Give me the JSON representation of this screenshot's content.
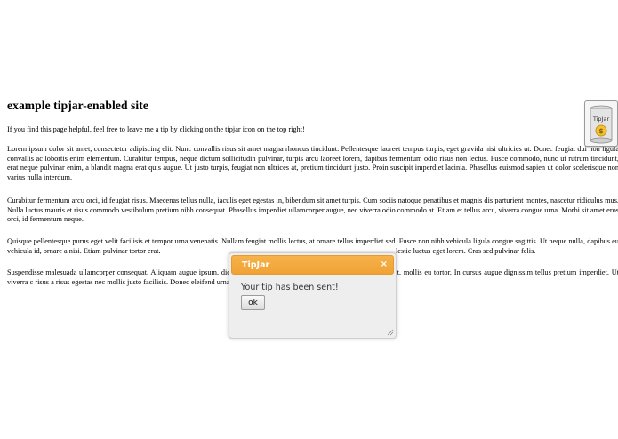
{
  "page": {
    "title": "example tipjar-enabled site",
    "intro": "If you find this page helpful, feel free to leave me a tip by clicking on the tipjar icon on the top right!",
    "paragraphs": [
      "Lorem ipsum dolor sit amet, consectetur adipiscing elit. Nunc convallis risus sit amet magna rhoncus tincidunt. Pellentesque laoreet tempus turpis, eget gravida nisi ultricies ut. Donec feugiat dui non ligula convallis ac lobortis enim elementum. Curabitur tempus, neque dictum sollicitudin pulvinar, turpis arcu laoreet lorem, dapibus fermentum odio risus non lectus. Fusce commodo, nunc ut rutrum tincidunt, erat neque pulvinar enim, a blandit magna erat quis augue. Ut justo turpis, feugiat non ultrices at, pretium tincidunt justo. Proin suscipit imperdiet lacinia. Phasellus euismod sapien ut dolor scelerisque non varius nulla interdum.",
      "Curabitur fermentum arcu orci, id feugiat risus. Maecenas tellus nulla, iaculis eget egestas in, bibendum sit amet turpis. Cum sociis natoque penatibus et magnis dis parturient montes, nascetur ridiculus mus. Nulla luctus mauris et risus commodo vestibulum pretium nibh consequat. Phasellus imperdiet ullamcorper augue, nec viverra odio commodo at. Etiam et tellus arcu, viverra congue urna. Morbi sit amet eros orci, id fermentum neque.",
      "Quisque pellentesque purus eget velit facilisis et tempor urna venenatis. Nullam feugiat mollis lectus, at ornare tellus imperdiet sed. Fusce non nibh vehicula ligula congue sagittis. Ut neque nulla, dapibus eu vehicula id, ornare a nisi. Etiam pulvinar tortor erat.",
      "Suspendisse malesuada ullamcorper consequat. Aliquam augue ipsum, dictum lacus. Sed nibh augue, porta in vestibulum sit amet, mollis eu tortor. In cursus augue dignissim tellus pretium imperdiet. Ut viverra c risus a risus egestas nec mollis justo facilisis. Donec eleifend urna eget tortor hendrerit sollicitudin."
    ],
    "p3_tail": "lestie luctus eget lorem. Cras sed pulvinar felis."
  },
  "tipjar": {
    "label": "TipJar",
    "coin_symbol": "$",
    "icon": "tipjar-icon"
  },
  "dialog": {
    "title": "TipJar",
    "close_symbol": "×",
    "message": "Your tip has been sent!",
    "ok_label": "ok"
  },
  "colors": {
    "dialog_titlebar": "#f0a236",
    "coin": "#f2c232"
  }
}
